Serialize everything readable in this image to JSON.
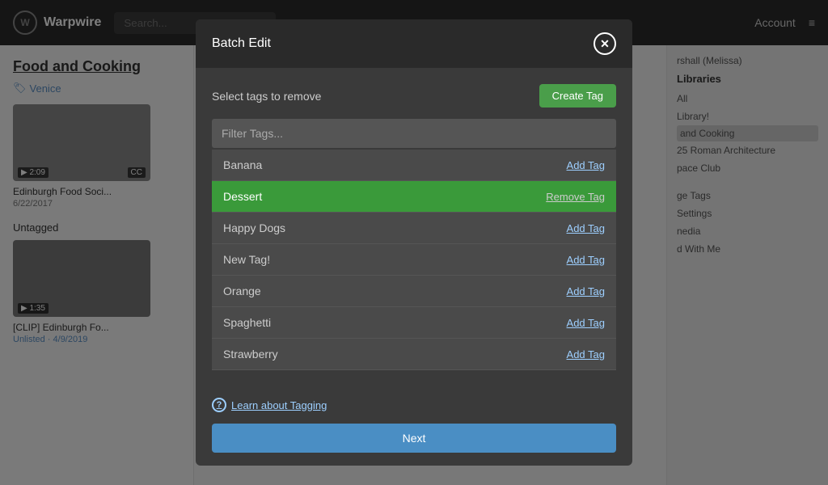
{
  "app": {
    "logo_text": "Warpwire",
    "logo_icon": "W",
    "search_placeholder": "Search...",
    "account_label": "Account",
    "menu_icon": "≡"
  },
  "sidebar_left": {
    "title": "Food and Cooking",
    "tag_label": "Venice",
    "section_untagged": "Untagged",
    "video1": {
      "title": "Edinburgh Food Soci...",
      "date": "6/22/2017",
      "duration": "2:09",
      "badge": "CC"
    },
    "video2": {
      "title": "[CLIP] Edinburgh Fo...",
      "meta": "Unlisted · 4/9/2019",
      "duration": "1:35"
    }
  },
  "sidebar_right": {
    "user": "rshall (Melissa)",
    "libraries_label": "Libraries",
    "items": [
      "All",
      "Library!",
      "and Cooking",
      "25 Roman Architecture",
      "pace Club",
      "ge Tags",
      "Settings",
      "nedia",
      "d With Me"
    ]
  },
  "modal": {
    "title": "Batch Edit",
    "close_icon": "✕",
    "subtitle": "Select tags to remove",
    "create_tag_label": "Create Tag",
    "filter_placeholder": "Filter Tags...",
    "tags": [
      {
        "name": "Banana",
        "action": "Add Tag",
        "selected": false
      },
      {
        "name": "Dessert",
        "action": "Remove Tag",
        "selected": true
      },
      {
        "name": "Happy Dogs",
        "action": "Add Tag",
        "selected": false
      },
      {
        "name": "New Tag!",
        "action": "Add Tag",
        "selected": false
      },
      {
        "name": "Orange",
        "action": "Add Tag",
        "selected": false
      },
      {
        "name": "Spaghetti",
        "action": "Add Tag",
        "selected": false
      },
      {
        "name": "Strawberry",
        "action": "Add Tag",
        "selected": false
      }
    ],
    "learn_label": "Learn about Tagging",
    "next_label": "Next",
    "help_icon": "?"
  }
}
